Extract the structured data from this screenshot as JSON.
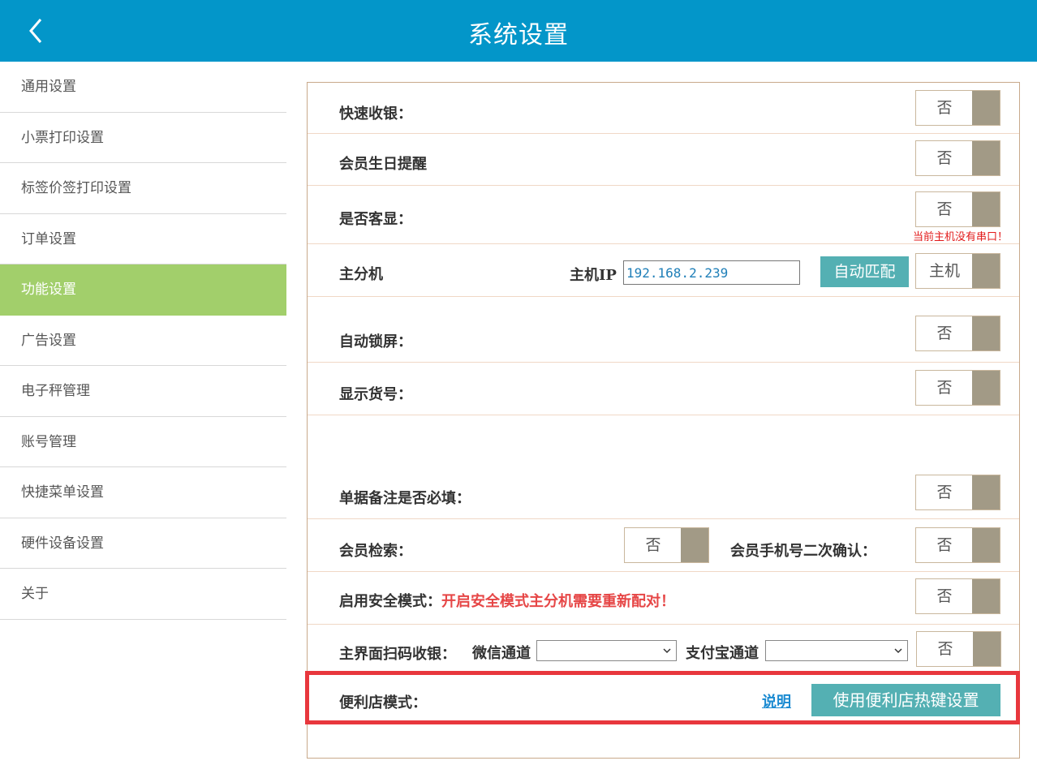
{
  "header": {
    "title": "系统设置"
  },
  "sidebar": {
    "items": [
      {
        "label": "通用设置"
      },
      {
        "label": "小票打印设置"
      },
      {
        "label": "标签价签打印设置"
      },
      {
        "label": "订单设置"
      },
      {
        "label": "功能设置",
        "active": true
      },
      {
        "label": "广告设置"
      },
      {
        "label": "电子秤管理"
      },
      {
        "label": "账号管理"
      },
      {
        "label": "快捷菜单设置"
      },
      {
        "label": "硬件设备设置"
      },
      {
        "label": "关于"
      }
    ]
  },
  "settings": {
    "quick_checkout": {
      "label": "快速收银：",
      "value": "否"
    },
    "member_birthday": {
      "label": "会员生日提醒",
      "value": "否"
    },
    "customer_display": {
      "label": "是否客显：",
      "value": "否",
      "warning": "当前主机没有串口！"
    },
    "host_split": {
      "label": "主分机",
      "ip_label": "主机IP",
      "ip_value": "192.168.2.239",
      "auto_match": "自动匹配",
      "value": "主机"
    },
    "auto_lock": {
      "label": "自动锁屏：",
      "value": "否"
    },
    "show_item_no": {
      "label": "显示货号：",
      "value": "否"
    },
    "remark_required": {
      "label": "单据备注是否必填：",
      "value": "否"
    },
    "member_search": {
      "label": "会员检索：",
      "value": "否",
      "phone_confirm_label": "会员手机号二次确认：",
      "phone_confirm_value": "否"
    },
    "safe_mode": {
      "label": "启用安全模式：",
      "warning": "开启安全模式主分机需要重新配对！",
      "value": "否"
    },
    "scan_checkout": {
      "label": "主界面扫码收银：",
      "wechat_label": "微信通道",
      "wechat_value": "",
      "alipay_label": "支付宝通道",
      "alipay_value": "",
      "value": "否"
    },
    "convenience_mode": {
      "label": "便利店模式：",
      "explain_link": "说明",
      "hotkey_button": "使用便利店热键设置"
    }
  },
  "colors": {
    "header_bg": "#0396c9",
    "active_sidebar": "#a2cf6b",
    "button_teal": "#54b0b3",
    "toggle_knob": "#a29a86",
    "warning_red": "#e64646",
    "highlight_red": "#e8373d"
  }
}
